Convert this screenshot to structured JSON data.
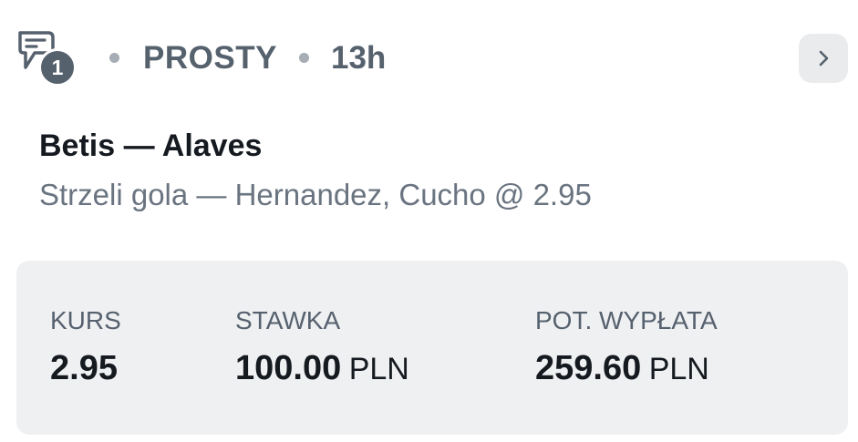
{
  "header": {
    "slip_icon": "bet-slip-icon",
    "selection_count": "1",
    "bet_type": "PROSTY",
    "time_ago": "13h",
    "details_icon": "chevron-right-icon"
  },
  "event": {
    "name": "Betis — Alaves",
    "selection": "Strzeli gola — Hernandez, Cucho @ 2.95"
  },
  "summary": {
    "odds_label": "KURS",
    "odds_value": "2.95",
    "stake_label": "STAWKA",
    "stake_value": "100.00",
    "stake_currency": "PLN",
    "payout_label": "POT. WYPŁATA",
    "payout_value": "259.60",
    "payout_currency": "PLN"
  },
  "colors": {
    "muted_text": "#56616e",
    "primary_text": "#151a20",
    "secondary_text": "#6a7480",
    "panel_background": "#eff0f2",
    "button_background": "#e9ebed",
    "separator_dot": "#a7adb4"
  }
}
